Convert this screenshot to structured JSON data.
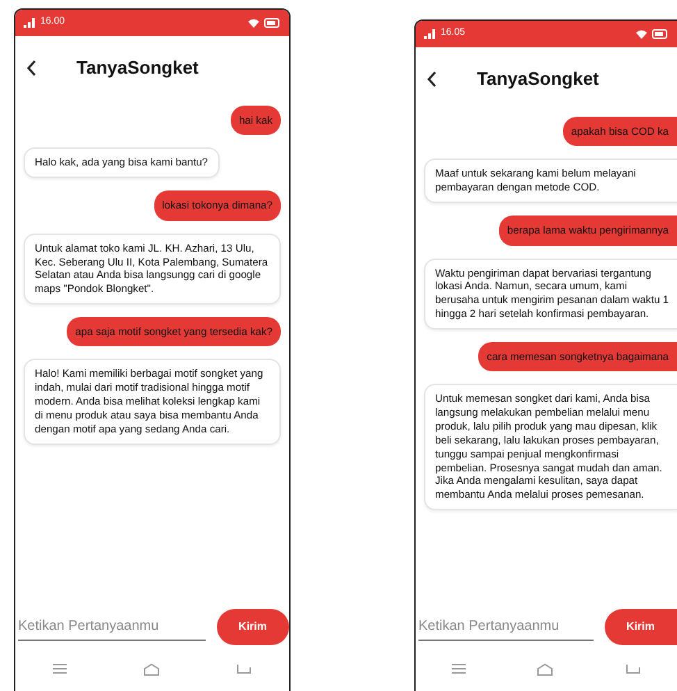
{
  "phones": [
    {
      "status_time": "16.00",
      "title": "TanyaSongket",
      "messages": [
        {
          "kind": "user",
          "text": "hai kak"
        },
        {
          "kind": "bot",
          "text": "Halo kak, ada yang bisa kami bantu?"
        },
        {
          "kind": "user",
          "text": "lokasi tokonya dimana?"
        },
        {
          "kind": "bot",
          "text": "Untuk alamat toko kami JL. KH. Azhari, 13 Ulu, Kec. Seberang Ulu II, Kota Palembang, Sumatera Selatan atau Anda bisa langsungg cari di google maps \"Pondok Blongket\"."
        },
        {
          "kind": "user",
          "text": "apa saja motif songket yang tersedia kak?"
        },
        {
          "kind": "bot",
          "text": "Halo! Kami memiliki berbagai motif songket yang indah, mulai dari motif tradisional hingga motif modern. Anda bisa melihat koleksi lengkap kami di menu produk atau saya bisa membantu Anda dengan motif apa yang sedang Anda cari."
        }
      ],
      "input": {
        "placeholder": "Ketikan Pertanyaanmu"
      },
      "send_button": "Kirim"
    },
    {
      "status_time": "16.05",
      "title": "TanyaSongket",
      "messages": [
        {
          "kind": "user",
          "text": "apakah bisa COD ka"
        },
        {
          "kind": "bot",
          "text": "Maaf untuk sekarang kami belum melayani pembayaran dengan metode COD."
        },
        {
          "kind": "user",
          "text": "berapa lama waktu pengirimannya"
        },
        {
          "kind": "bot",
          "text": "Waktu pengiriman dapat bervariasi tergantung lokasi Anda. Namun, secara umum, kami berusaha untuk mengirim pesanan dalam waktu 1 hingga 2 hari setelah konfirmasi pembayaran."
        },
        {
          "kind": "user",
          "text": "cara memesan songketnya bagaimana"
        },
        {
          "kind": "bot",
          "text": "Untuk memesan songket dari kami, Anda bisa langsung melakukan pembelian melalui menu produk, lalu pilih produk yang mau dipesan, klik beli sekarang, lalu lakukan proses pembayaran, tunggu sampai penjual mengkonfirmasi pembelian. Prosesnya sangat mudah dan aman. Jika Anda mengalami kesulitan, saya dapat membantu Anda melalui proses pemesanan."
        }
      ],
      "input": {
        "placeholder": "Ketikan Pertanyaanmu"
      },
      "send_button": "Kirim"
    }
  ]
}
